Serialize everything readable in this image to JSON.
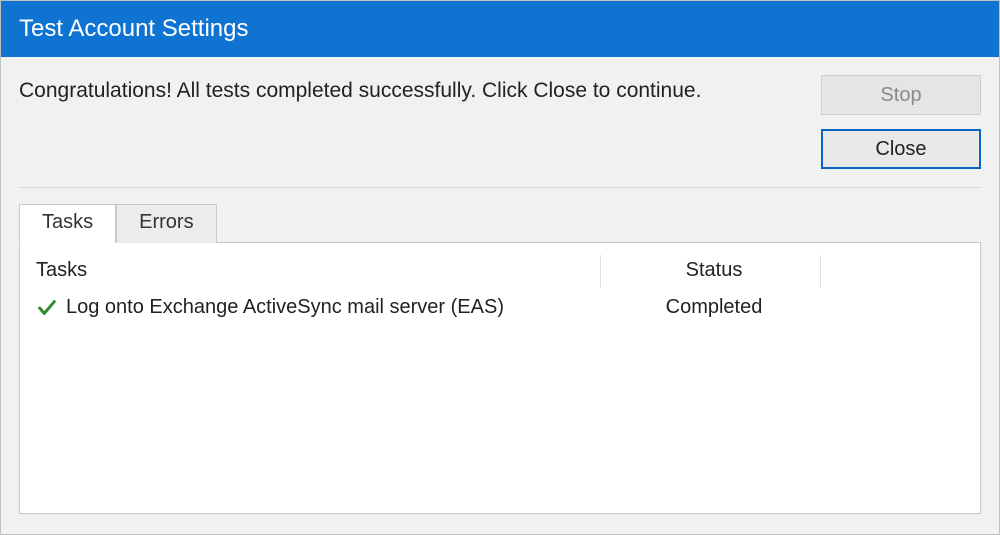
{
  "window": {
    "title": "Test Account Settings"
  },
  "message": "Congratulations! All tests completed successfully. Click Close to continue.",
  "buttons": {
    "stop": "Stop",
    "close": "Close"
  },
  "tabs": {
    "tasks": "Tasks",
    "errors": "Errors"
  },
  "table": {
    "headers": {
      "tasks": "Tasks",
      "status": "Status"
    },
    "rows": [
      {
        "icon": "check",
        "task": "Log onto Exchange ActiveSync mail server (EAS)",
        "status": "Completed"
      }
    ]
  }
}
